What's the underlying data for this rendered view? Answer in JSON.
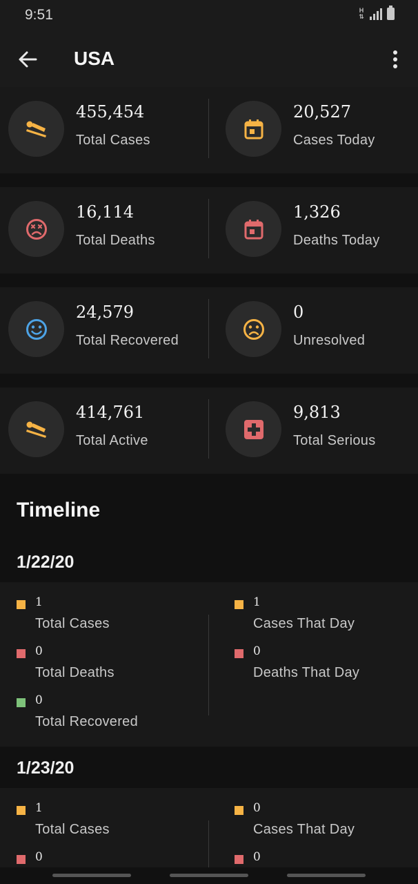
{
  "status_bar": {
    "time": "9:51",
    "network": "H"
  },
  "header": {
    "title": "USA"
  },
  "stats": {
    "total_cases": {
      "value": "455,454",
      "label": "Total Cases"
    },
    "cases_today": {
      "value": "20,527",
      "label": "Cases Today"
    },
    "total_deaths": {
      "value": "16,114",
      "label": "Total Deaths"
    },
    "deaths_today": {
      "value": "1,326",
      "label": "Deaths Today"
    },
    "total_recovered": {
      "value": "24,579",
      "label": "Total Recovered"
    },
    "unresolved": {
      "value": "0",
      "label": "Unresolved"
    },
    "total_active": {
      "value": "414,761",
      "label": "Total Active"
    },
    "total_serious": {
      "value": "9,813",
      "label": "Total Serious"
    }
  },
  "timeline": {
    "title": "Timeline",
    "days": [
      {
        "date": "1/22/20",
        "total_cases": {
          "value": "1",
          "label": "Total Cases"
        },
        "cases_that_day": {
          "value": "1",
          "label": "Cases That Day"
        },
        "total_deaths": {
          "value": "0",
          "label": "Total Deaths"
        },
        "deaths_that_day": {
          "value": "0",
          "label": "Deaths That Day"
        },
        "total_recovered": {
          "value": "0",
          "label": "Total Recovered"
        }
      },
      {
        "date": "1/23/20",
        "total_cases": {
          "value": "1",
          "label": "Total Cases"
        },
        "cases_that_day": {
          "value": "0",
          "label": "Cases That Day"
        },
        "total_deaths": {
          "value": "0"
        },
        "deaths_that_day": {
          "value": "0"
        }
      }
    ]
  },
  "colors": {
    "orange": "#f6b345",
    "red": "#e06a6c",
    "blue": "#4da3e6",
    "green": "#7ec27a",
    "background": "#111111",
    "card": "#191919"
  },
  "icons": {
    "total_cases": "patient-bed-icon",
    "cases_today": "calendar-icon",
    "total_deaths": "dead-face-icon",
    "deaths_today": "calendar-icon",
    "total_recovered": "smile-face-icon",
    "unresolved": "sad-face-icon",
    "total_active": "patient-bed-icon",
    "total_serious": "medical-cross-icon"
  }
}
